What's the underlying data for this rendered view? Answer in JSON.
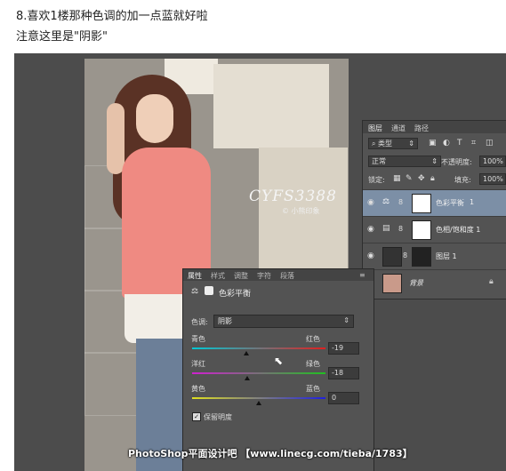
{
  "caption": {
    "line1": "8.喜欢1楼那种色调的加一点蓝就好啦",
    "line2": "注意这里是\"阴影\""
  },
  "photo": {
    "signature": "CYFS3388",
    "signature_sub": "© 小熊印象"
  },
  "layers_panel": {
    "tabs": [
      "图层",
      "通道",
      "路径"
    ],
    "kind_filter": "类型",
    "blend_mode": "正常",
    "opacity_label": "不透明度:",
    "opacity": "100%",
    "lock_label": "锁定:",
    "fill_label": "填充:",
    "fill": "100%",
    "layers": [
      {
        "name": "色彩平衡 1",
        "selected": true,
        "icon": "balance-icon"
      },
      {
        "name": "色相/饱和度 1",
        "selected": false,
        "icon": "hue-icon"
      },
      {
        "name": "图层 1",
        "selected": false,
        "icon": "layer-icon"
      },
      {
        "name": "背景",
        "selected": false,
        "icon": "lock-icon"
      }
    ]
  },
  "properties_panel": {
    "tabs": [
      "属性",
      "样式",
      "调整",
      "字符",
      "段落"
    ],
    "title": "色彩平衡",
    "tone_label": "色调:",
    "tone_value": "阴影",
    "sliders": [
      {
        "left": "青色",
        "right": "红色",
        "value": "-19",
        "min": -100,
        "max": 100,
        "colors": [
          "#00c9d6",
          "#e02020"
        ]
      },
      {
        "left": "洋红",
        "right": "绿色",
        "value": "-18",
        "min": -100,
        "max": 100,
        "colors": [
          "#d020d0",
          "#20c020"
        ]
      },
      {
        "left": "黄色",
        "right": "蓝色",
        "value": "0",
        "min": -100,
        "max": 100,
        "colors": [
          "#e0e020",
          "#2020e0"
        ]
      }
    ],
    "preserve_label": "保留明度",
    "preserve_checked": true
  },
  "watermark": "PhotoShop平面设计吧 【www.linecg.com/tieba/1783】"
}
